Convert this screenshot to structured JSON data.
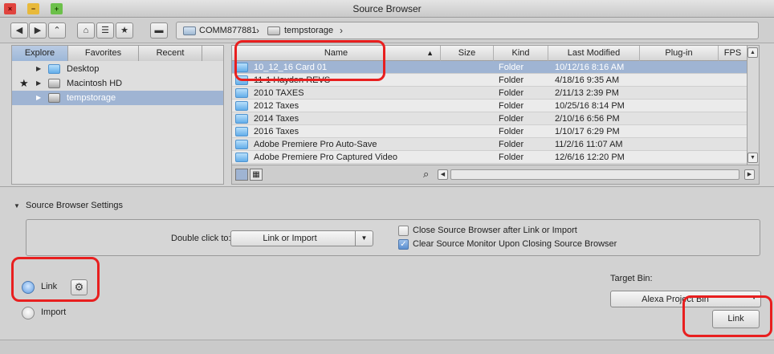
{
  "window": {
    "title": "Source Browser",
    "controls": {
      "close": "×",
      "minimize": "−",
      "maximize": "+"
    }
  },
  "nav": {
    "back_icon": "arrow-left-icon",
    "forward_icon": "arrow-right-icon",
    "up_icon": "caret-up-icon",
    "home_icon": "home-icon",
    "list_icon": "list-icon",
    "favorite_icon": "star-icon",
    "drive_icon": "drive-icon",
    "path": [
      {
        "label": "COMM877881",
        "icon": "computer-icon"
      },
      {
        "label": "tempstorage",
        "icon": "disk-icon"
      }
    ]
  },
  "left_pane": {
    "tabs": [
      "Explore",
      "Favorites",
      "Recent"
    ],
    "active_tab": "Explore",
    "tree": [
      {
        "label": "Desktop",
        "starred": false,
        "icon": "folder-icon",
        "selected": false
      },
      {
        "label": "Macintosh HD",
        "starred": true,
        "icon": "hard-drive-icon",
        "selected": false
      },
      {
        "label": "tempstorage",
        "starred": false,
        "icon": "hard-drive-icon",
        "selected": true
      }
    ]
  },
  "file_list": {
    "columns": [
      "Name",
      "Size",
      "Kind",
      "Last Modified",
      "Plug-in",
      "FPS"
    ],
    "sort_indicator": "▲",
    "rows": [
      {
        "name": "10_12_16 Card 01",
        "size": "",
        "kind": "Folder",
        "modified": "10/12/16 8:16 AM",
        "selected": true
      },
      {
        "name": "11-1 Hayden REVS",
        "size": "",
        "kind": "Folder",
        "modified": "4/18/16 9:35 AM",
        "selected": false
      },
      {
        "name": "2010 TAXES",
        "size": "",
        "kind": "Folder",
        "modified": "2/11/13 2:39 PM",
        "selected": false
      },
      {
        "name": "2012 Taxes",
        "size": "",
        "kind": "Folder",
        "modified": "10/25/16 8:14 PM",
        "selected": false
      },
      {
        "name": "2014 Taxes",
        "size": "",
        "kind": "Folder",
        "modified": "2/10/16 6:56 PM",
        "selected": false
      },
      {
        "name": "2016 Taxes",
        "size": "",
        "kind": "Folder",
        "modified": "1/10/17 6:29 PM",
        "selected": false
      },
      {
        "name": "Adobe Premiere Pro Auto-Save",
        "size": "",
        "kind": "Folder",
        "modified": "11/2/16 11:07 AM",
        "selected": false
      },
      {
        "name": "Adobe Premiere Pro Captured Video",
        "size": "",
        "kind": "Folder",
        "modified": "12/6/16 12:20 PM",
        "selected": false
      }
    ]
  },
  "settings": {
    "title": "Source Browser Settings",
    "double_click_label": "Double click to:",
    "double_click_value": "Link or Import",
    "checkboxes": [
      {
        "label": "Close Source Browser after Link or Import",
        "checked": false
      },
      {
        "label": "Clear Source Monitor Upon Closing Source Browser",
        "checked": true
      }
    ]
  },
  "mode": {
    "options": [
      "Link",
      "Import"
    ],
    "selected": "Link",
    "gear_icon": "gear-icon"
  },
  "target_bin": {
    "label": "Target Bin:",
    "value": "Alexa Project Bin"
  },
  "action_button": "Link",
  "colors": {
    "highlight": "#e81f1f",
    "selection": "#9fb4d3",
    "folder": "#63aee9"
  }
}
